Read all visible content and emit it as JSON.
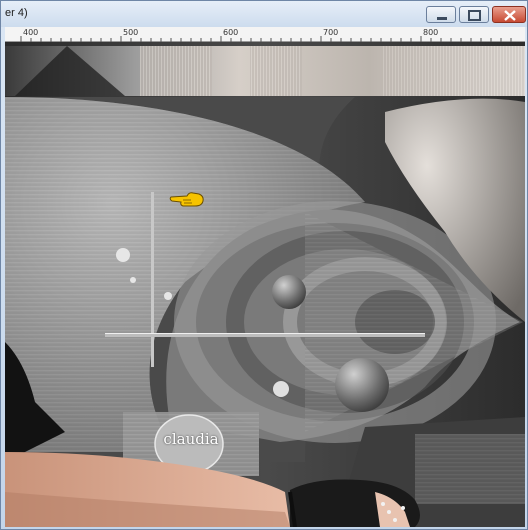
{
  "window": {
    "title": "er 4)",
    "minimize_icon": "minimize-icon",
    "maximize_icon": "maximize-icon",
    "close_icon": "close-icon"
  },
  "ruler": {
    "labels": [
      "400",
      "500",
      "600",
      "700",
      "800"
    ]
  },
  "canvas": {
    "watermark_text": "claudia",
    "pointer_icon": "pointing-hand-icon"
  },
  "colors": {
    "title_bg": "#d8e5f3",
    "close_button": "#c74a33",
    "pointer": "#f6c300"
  }
}
